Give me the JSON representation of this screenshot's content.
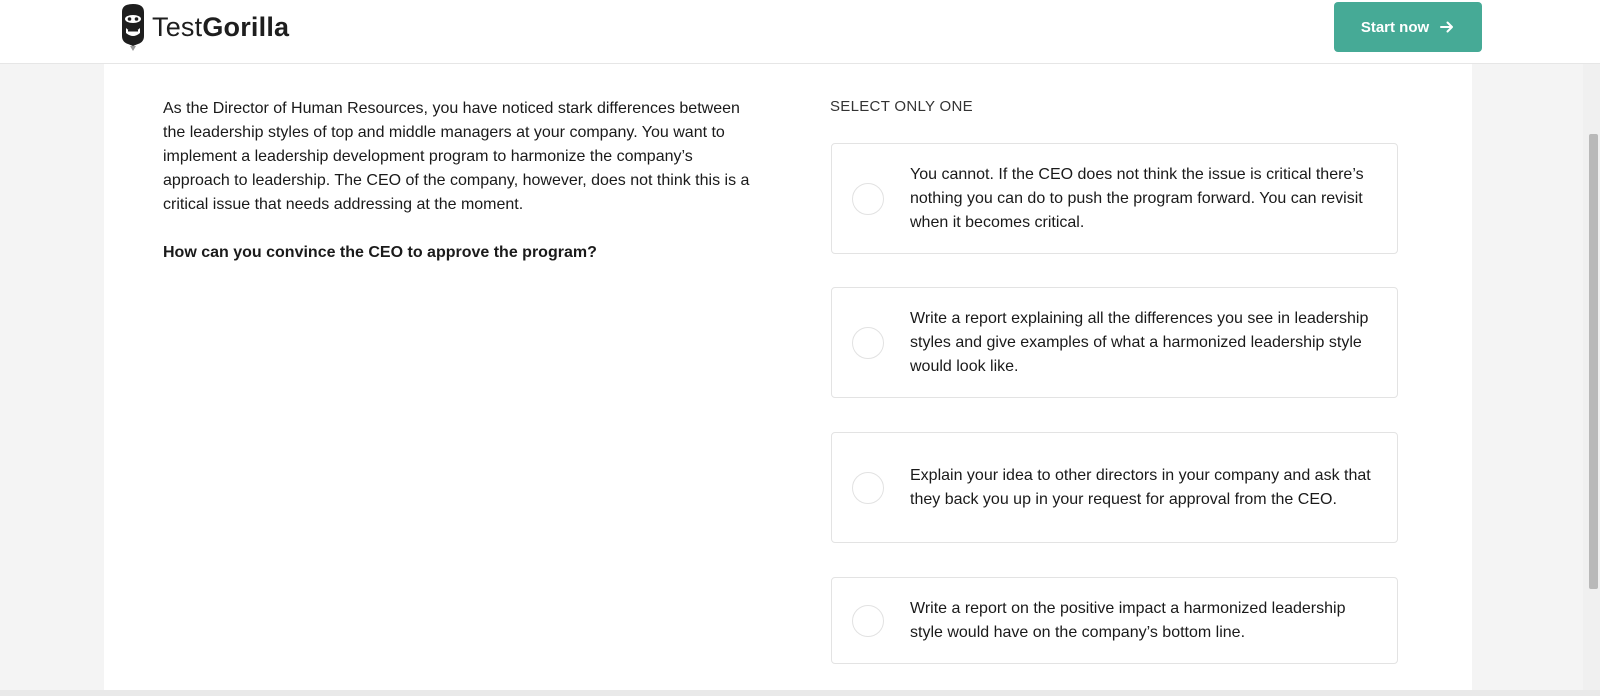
{
  "header": {
    "logo_icon": "gorilla-logo-icon",
    "logo_text_light": "Test",
    "logo_text_bold": "Gorilla",
    "start_label": "Start now",
    "start_icon": "arrow-right-icon",
    "accent_color": "#46aa96"
  },
  "question": {
    "scenario": "As the Director of Human Resources, you have noticed stark differences between the leadership styles of top and middle managers at your company. You want to implement a leadership development program to harmonize the company’s approach to leadership. The CEO of the company, however, does not think this is a critical issue that needs addressing at the moment.",
    "prompt": "How can you convince the CEO to approve the program?"
  },
  "answers": {
    "instruction": "SELECT ONLY ONE",
    "options": [
      {
        "text": "You cannot. If the CEO does not think the issue is critical there’s nothing you can do to push the program forward. You can revisit when it becomes critical."
      },
      {
        "text": "Write a report explaining all the differences you see in leadership styles and give examples of what a harmonized leadership style would look like."
      },
      {
        "text": "Explain your idea to other directors in your company and ask that they back you up in your request for approval from the CEO."
      },
      {
        "text": "Write a report on the positive impact a harmonized leadership style would have on the company’s bottom line."
      }
    ]
  }
}
